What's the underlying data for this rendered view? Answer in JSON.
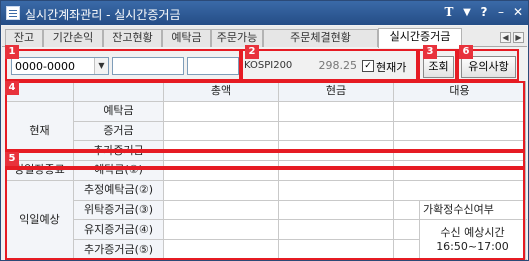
{
  "window": {
    "title": "실시간계좌관리 - 실시간증거금"
  },
  "titlebar_buttons": {
    "t": "T",
    "pin": "▼",
    "help": "?",
    "minimize": "–",
    "close": "✕"
  },
  "tabs": [
    "잔고",
    "기간손익",
    "잔고현황",
    "예탁금",
    "주문가능",
    "주문체결현황",
    "실시간증거금"
  ],
  "active_tab": "실시간증거금",
  "tab_nav": {
    "prev": "◀",
    "next": "▶"
  },
  "controls": {
    "account_select": "0000-0000",
    "combo_arrow": "▼",
    "kospi_label": "KOSPI200",
    "kospi_value": "298.25",
    "check_mark": "✓",
    "current_price_check_label": "현재가",
    "lookup_button": "조회",
    "notice_button": "유의사항"
  },
  "table": {
    "headers": {
      "total": "총액",
      "cash": "현금",
      "substitute": "대용"
    },
    "group_current": "현재",
    "group_today_close": "당일장종료",
    "group_next_day": "익일예상",
    "rows_current": [
      "예탁금",
      "증거금",
      "추가증거금"
    ],
    "row_today_close": "예탁금(①)",
    "rows_next_day": [
      "추정예탁금(②)",
      "위탁증거금(③)",
      "유지증거금(④)",
      "추가증거금(⑤)"
    ],
    "aside_label": "가확정수신여부",
    "aside_time_label": "수신 예상시간",
    "aside_time_value": "16:50~17:00"
  },
  "badges": [
    "1",
    "2",
    "3",
    "4",
    "5",
    "6"
  ],
  "colors": {
    "titlebar": "#2f5c9a",
    "highlight_red": "#e61b23",
    "badge_red": "#e8323c"
  }
}
